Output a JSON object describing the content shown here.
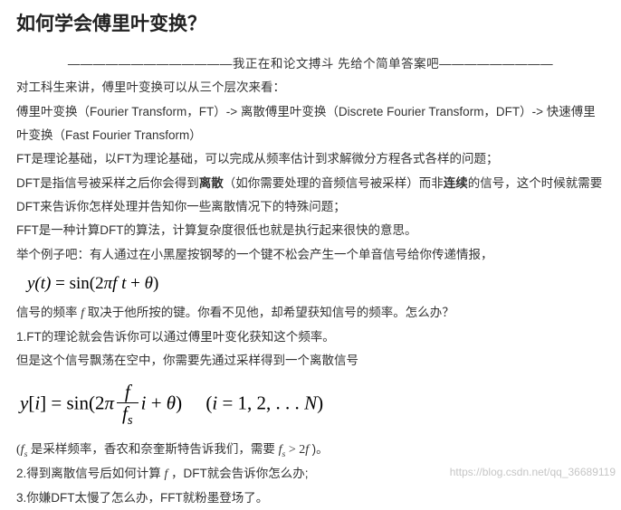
{
  "title": "如何学会傅里叶变换？",
  "intro_center": "—————————————我正在和论文搏斗 先给个简单答案吧—————————",
  "p1": "对工科生来讲，傅里叶变换可以从三个层次来看：",
  "p2": "傅里叶变换（Fourier Transform，FT）-> 离散傅里叶变换（Discrete Fourier Transform，DFT）-> 快速傅里叶变换（Fast Fourier Transform）",
  "p3": "FT是理论基础，以FT为理论基础，可以完成从频率估计到求解微分方程各式各样的问题；",
  "p4a": "DFT是指信号被采样之后你会得到",
  "p4_em1": "离散",
  "p4b": "（如你需要处理的音频信号被采样）而非",
  "p4_em2": "连续",
  "p4c": "的信号，这个时候就需要DFT来告诉你怎样处理并告知你一些离散情况下的特殊问题；",
  "p5": "FFT是一种计算DFT的算法，计算复杂度很低也就是执行起来很快的意思。",
  "p6": "举个例子吧：有人通过在小黑屋按钢琴的一个键不松会产生一个单音信号给你传递情报，",
  "formula1_raw": "y(t) = sin(2πft + θ)",
  "formula1_html": "y(t) = <span class=\"upright\">sin</span>(2πf t + θ)",
  "p7a": "信号的频率 ",
  "p7_var": "f",
  "p7b": " 取决于他所按的键。你看不见他，却希望获知信号的频率。怎么办？",
  "p8": "1.FT的理论就会告诉你可以通过傅里叶变化获知这个频率。",
  "p9": "但是这个信号飘荡在空中，你需要先通过采样得到一个离散信号",
  "formula2": {
    "left": "y[i] = sin(2π (f/fs) i + θ)",
    "right": "(i = 1, 2, ... N)"
  },
  "p10a": "(",
  "p10_fs": "f",
  "p10_s": "s",
  "p10b": " 是采样频率，香农和奈奎斯特告诉我们，需要 ",
  "p10_cond": "f_s > 2f",
  "p10c": ")。",
  "p11a": "2.得到离散信号后如何计算 ",
  "p11_var": "f",
  "p11b": " ，DFT就会告诉你怎么办;",
  "p12": "3.你嫌DFT太慢了怎么办，FFT就粉墨登场了。",
  "watermark": "https://blog.csdn.net/qq_36689119"
}
